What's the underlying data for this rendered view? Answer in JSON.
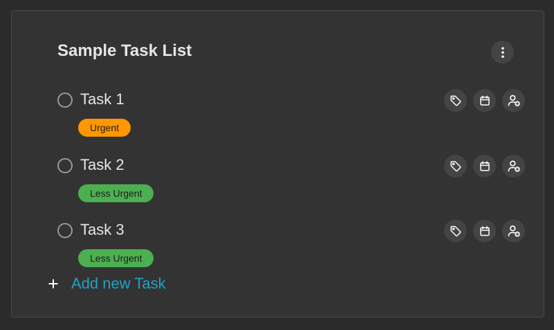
{
  "list": {
    "title": "Sample Task List",
    "more_icon": "more-vertical-icon"
  },
  "colors": {
    "background": "#2b2b2b",
    "card": "#333333",
    "urgent": "#ff9800",
    "less_urgent": "#4caf50",
    "accent": "#1fa3c9"
  },
  "tasks": [
    {
      "name": "Task 1",
      "priority": "Urgent",
      "priority_color": "#ff9800"
    },
    {
      "name": "Task 2",
      "priority": "Less Urgent",
      "priority_color": "#4caf50"
    },
    {
      "name": "Task 3",
      "priority": "Less Urgent",
      "priority_color": "#4caf50"
    }
  ],
  "task_actions": {
    "tag_icon": "tag-icon",
    "calendar_icon": "calendar-icon",
    "assign_icon": "add-user-icon"
  },
  "add_task": {
    "label": "Add new Task",
    "icon": "plus-icon"
  }
}
